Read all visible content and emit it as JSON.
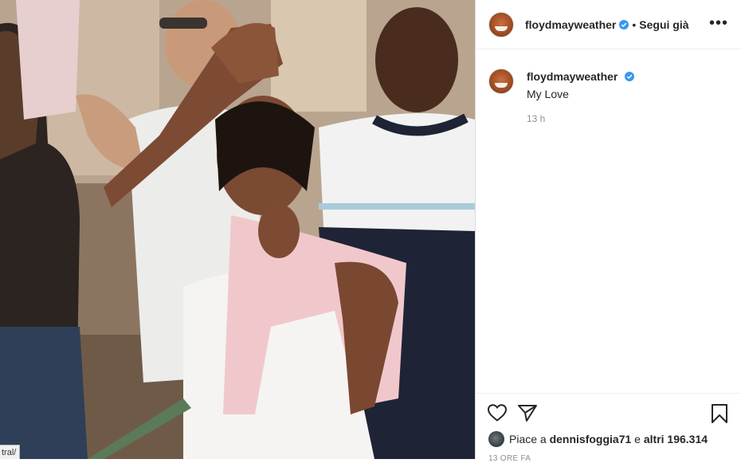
{
  "post": {
    "username": "floydmayweather",
    "verified": true,
    "follow_separator": "•",
    "follow_label": "Segui già",
    "more_label": "•••",
    "caption": "My Love",
    "time": "13 h",
    "likes": {
      "prefix": "Piace a",
      "user": "dennisfoggia71",
      "joiner": "e",
      "others": "altri 196.314"
    },
    "date_partial": "13 ORE FA"
  },
  "browser": {
    "url_fragment": "tral/"
  },
  "colors": {
    "verified_blue": "#3897f0",
    "text": "#262626",
    "muted": "#8e8e8e"
  },
  "icons": [
    "verified-badge-icon",
    "more-options-icon",
    "heart-icon",
    "share-icon",
    "bookmark-icon"
  ]
}
